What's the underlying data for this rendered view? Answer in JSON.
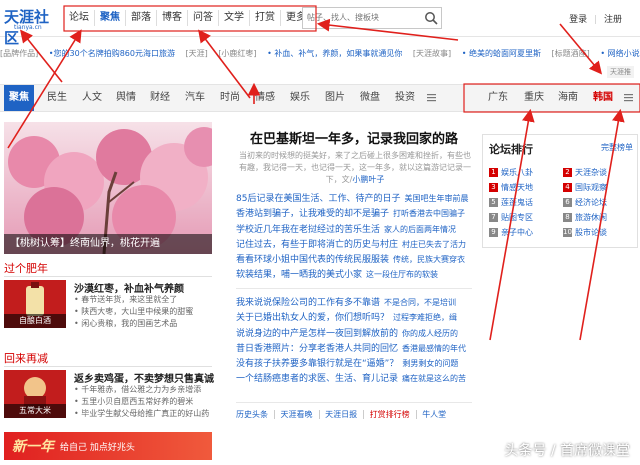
{
  "header": {
    "logo_main": "天涯社区",
    "logo_sub": "tianya.cn",
    "nav": [
      "论坛",
      "聚焦",
      "部落",
      "博客",
      "问答",
      "文学",
      "打赏",
      "更多"
    ],
    "search_placeholder": "帖子、找人、搜板块",
    "login": "登录",
    "register": "注册"
  },
  "ticker": {
    "items": [
      "[品牌作品]",
      "•您的30个名牌拍购860元海口旅游",
      "[天涯]",
      "[小鹿红枣]",
      "• 补血、补气，养颜，如果事就通见你",
      "[天涯故事]",
      "• 绝美的蛤面阿夏里斯",
      "[标题酒座]",
      "• 网络小说，我的国画艺术品"
    ],
    "ad_label": "天涯推"
  },
  "channels": {
    "left": [
      "聚焦",
      "民生",
      "人文",
      "舆情",
      "财经",
      "汽车",
      "时尚",
      "情感",
      "娱乐",
      "图片",
      "微盘",
      "投资"
    ],
    "right": [
      "广东",
      "重庆",
      "海南",
      "韩国"
    ],
    "active": "聚焦",
    "highlight": "韩国"
  },
  "left": {
    "hero_caption": "【桃树认筹】终南仙界，桃花开遍",
    "sec1_title": "过个肥年",
    "item1_thumb": "自酿白酒",
    "item1_title": "沙漠红枣，补血补气养颜",
    "item1_lines": [
      "• 春节送年货，来这里就全了",
      "• 陕西大枣，大山里中候果的甜蜜",
      "• 闲心贵粮，我的国画艺术品"
    ],
    "sec2_title": "回来再减",
    "item2_thumb": "五常大米",
    "item2_title": "返乡卖鸡蛋，不卖梦想只售真诚",
    "item2_lines": [
      "• 千年雅赤，借公雅之力为乡亲增添",
      "• 五里小贝自愿西五常好养的碧米",
      "• 毕业学生献父母给推广真正的好山药"
    ],
    "banner_big": "新一年",
    "banner_small": "给自己 加点好兆头"
  },
  "center": {
    "headline": "在巴基斯坦一年多，记录我回家的路",
    "summary": "当初来的时候想的挺美好，来了之后碰上很多困难和挫折，有些也有趣，我记得一天，也记得一天，这一年多，就以这篇游记记录一下，文/",
    "summary_author": "小鹏叶子",
    "group1": [
      {
        "m": "85后记录在美国生活、工作、待产的日子",
        "s": "美国吧生年审前晨"
      },
      {
        "m": "香港站到骗子，让我难受的却不是骗子",
        "s": "打听香港去中国骗子"
      },
      {
        "m": "学校近几年我在老挝经过的苦乐生活",
        "s": "家人的后面两年情况"
      },
      {
        "m": "记住过去，有些于即将消亡的历史与村庄",
        "s": "村庄已失去了活力"
      },
      {
        "m": "看看环球小姐中国代表的传统民服服装",
        "s": "传统，民族大赛穿衣"
      },
      {
        "m": "软装结果，哺一晒我的美式小家",
        "s": "这一段住厅布的软装"
      }
    ],
    "group2": [
      {
        "m": "我来说说保险公司的工作有多不靠谱",
        "s": "不是合同，不是培训"
      },
      {
        "m": "关于已婚出轨女人的爱，你们想听吗？",
        "s": "过程李难拒绝，缉"
      },
      {
        "m": "说说身边的中产是怎样一夜回到解放前的",
        "s": "你的成人经历的"
      },
      {
        "m": "昔日香港照片：分享老香港人共同的回忆",
        "s": "香港最感情的年代"
      },
      {
        "m": "没有孩子扶养要多靠银行就是在“逼婚”？",
        "s": "剩男剩女的问题"
      },
      {
        "m": "一个结肠癌患者的求医、生活、育儿记录",
        "s": "痛在就是这么的苦"
      }
    ],
    "footer": [
      "历史头条",
      "天涯看晚",
      "天涯日报",
      "打赏排行榜",
      "牛人堂"
    ],
    "footer_highlight": "打赏排行榜"
  },
  "right": {
    "title": "论坛排行",
    "more": "完整榜单",
    "ranks": [
      {
        "n": "1",
        "label": "娱乐八卦",
        "color": "#d40000"
      },
      {
        "n": "2",
        "label": "天涯杂谈",
        "color": "#d40000"
      },
      {
        "n": "3",
        "label": "情感天地",
        "color": "#d40000"
      },
      {
        "n": "4",
        "label": "国际观察",
        "color": "#d40000"
      },
      {
        "n": "5",
        "label": "莲蓬鬼话",
        "color": "#777777"
      },
      {
        "n": "6",
        "label": "经济论坛",
        "color": "#777777"
      },
      {
        "n": "7",
        "label": "贴图专区",
        "color": "#777777"
      },
      {
        "n": "8",
        "label": "旅游休闲",
        "color": "#777777"
      },
      {
        "n": "9",
        "label": "亲子中心",
        "color": "#777777"
      },
      {
        "n": "10",
        "label": "股市论谈",
        "color": "#777777"
      }
    ]
  },
  "watermark": "头条号 / 首席微课堂",
  "colors": {
    "brand": "#1f63c4",
    "accent": "#d40000",
    "annotation": "#e0201c"
  }
}
